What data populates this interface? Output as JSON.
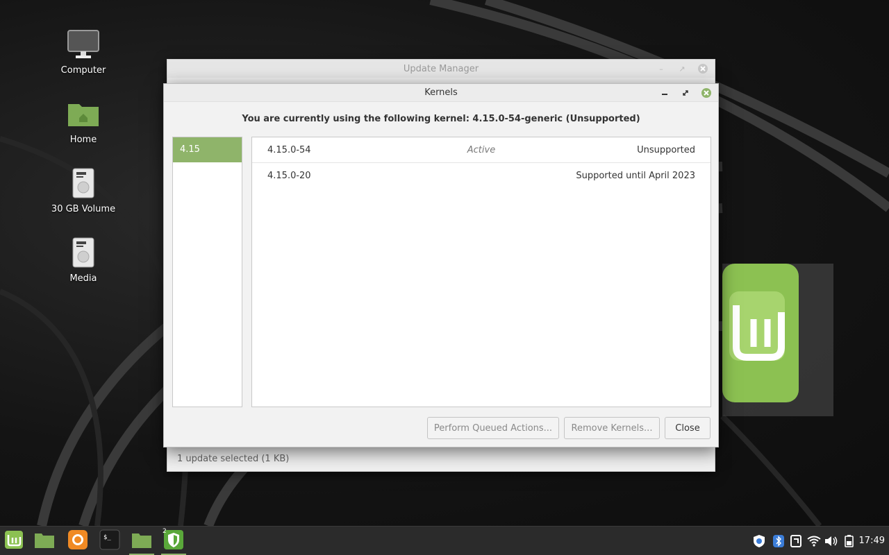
{
  "desktop": {
    "icons": [
      {
        "label": "Computer"
      },
      {
        "label": "Home"
      },
      {
        "label": "30 GB Volume"
      },
      {
        "label": "Media"
      }
    ]
  },
  "update_manager": {
    "title": "Update Manager",
    "status": "1 update selected (1 KB)"
  },
  "kernels": {
    "title": "Kernels",
    "heading": "You are currently using the following kernel: 4.15.0-54-generic (Unsupported)",
    "series": [
      {
        "label": "4.15",
        "selected": true
      }
    ],
    "rows": [
      {
        "version": "4.15.0-54",
        "state": "Active",
        "support": "Unsupported"
      },
      {
        "version": "4.15.0-20",
        "state": "",
        "support": "Supported until April 2023"
      }
    ],
    "buttons": {
      "queued": "Perform Queued Actions...",
      "remove": "Remove Kernels...",
      "close": "Close"
    }
  },
  "taskbar": {
    "workspace_badge": "2",
    "clock": "17:49",
    "items": [
      "mint-menu-icon",
      "show-desktop-icon",
      "firefox-icon",
      "terminal-icon",
      "files-icon",
      "update-manager-shield-icon"
    ]
  },
  "colors": {
    "accent": "#8fb46a",
    "taskbar": "#2b2b2b"
  }
}
